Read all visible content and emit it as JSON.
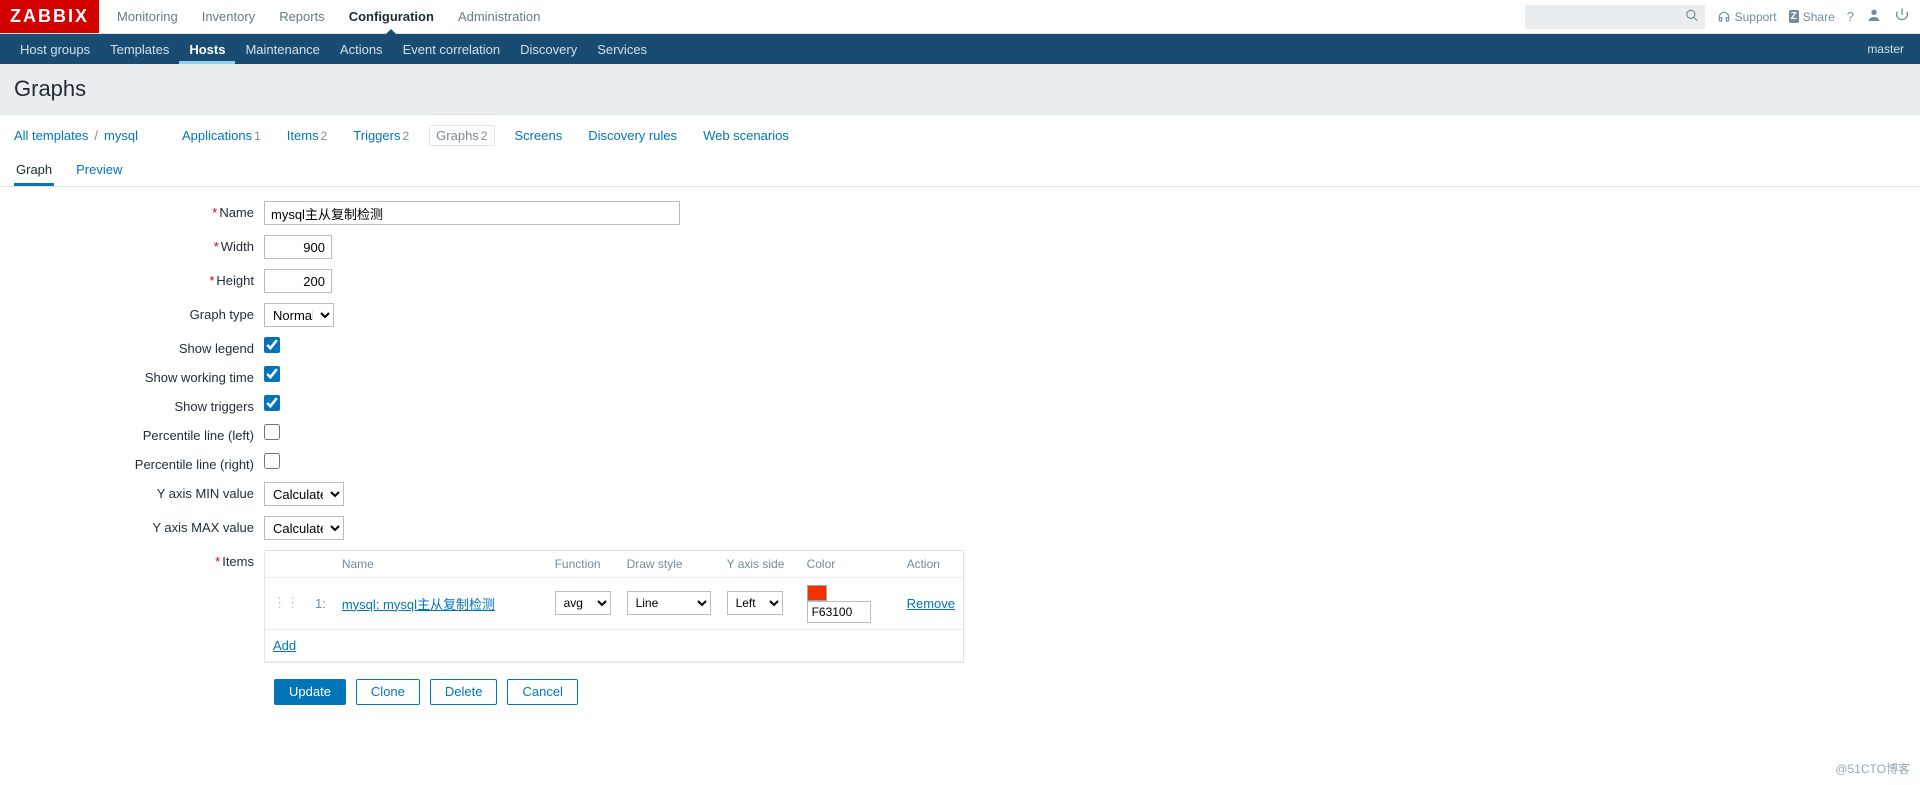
{
  "brand": "ZABBIX",
  "topnav": {
    "items": [
      "Monitoring",
      "Inventory",
      "Reports",
      "Configuration",
      "Administration"
    ],
    "active_index": 3,
    "support": "Support",
    "share": "Share"
  },
  "subnav": {
    "items": [
      "Host groups",
      "Templates",
      "Hosts",
      "Maintenance",
      "Actions",
      "Event correlation",
      "Discovery",
      "Services"
    ],
    "active_index": 2,
    "right": "master"
  },
  "page_title": "Graphs",
  "templatenav": {
    "all_templates": "All templates",
    "template_name": "mysql",
    "items": [
      {
        "label": "Applications",
        "count": "1"
      },
      {
        "label": "Items",
        "count": "2"
      },
      {
        "label": "Triggers",
        "count": "2"
      },
      {
        "label": "Graphs",
        "count": "2"
      },
      {
        "label": "Screens",
        "count": ""
      },
      {
        "label": "Discovery rules",
        "count": ""
      },
      {
        "label": "Web scenarios",
        "count": ""
      }
    ],
    "active_index": 3
  },
  "tabs": {
    "items": [
      "Graph",
      "Preview"
    ],
    "active_index": 0
  },
  "form": {
    "name_label": "Name",
    "name_value": "mysql主从复制检测",
    "width_label": "Width",
    "width_value": "900",
    "height_label": "Height",
    "height_value": "200",
    "graph_type_label": "Graph type",
    "graph_type_value": "Normal",
    "show_legend_label": "Show legend",
    "show_legend": true,
    "show_working_time_label": "Show working time",
    "show_working_time": true,
    "show_triggers_label": "Show triggers",
    "show_triggers": true,
    "perc_left_label": "Percentile line (left)",
    "perc_left": false,
    "perc_right_label": "Percentile line (right)",
    "perc_right": false,
    "ymin_label": "Y axis MIN value",
    "ymin_value": "Calculated",
    "ymax_label": "Y axis MAX value",
    "ymax_value": "Calculated",
    "items_label": "Items"
  },
  "items_table": {
    "headers": {
      "name": "Name",
      "function": "Function",
      "draw_style": "Draw style",
      "yaxis_side": "Y axis side",
      "color": "Color",
      "action": "Action"
    },
    "rows": [
      {
        "idx": "1:",
        "name": "mysql: mysql主从复制检测",
        "function": "avg",
        "draw_style": "Line",
        "yaxis_side": "Left",
        "color": "F63100",
        "color_hex": "#F63100",
        "action": "Remove"
      }
    ],
    "add": "Add"
  },
  "buttons": {
    "update": "Update",
    "clone": "Clone",
    "delete": "Delete",
    "cancel": "Cancel"
  },
  "watermark": "@51CTO博客"
}
